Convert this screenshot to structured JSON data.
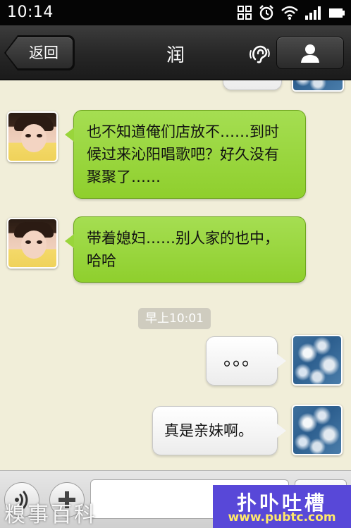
{
  "status_bar": {
    "time": "10:14",
    "icons": [
      "screen-rotate-icon",
      "alarm-icon",
      "wifi-icon",
      "signal-icon",
      "battery-icon"
    ]
  },
  "title_bar": {
    "back_label": "返回",
    "title": "润",
    "earpiece_icon": "earpiece-icon",
    "profile_icon": "person-icon"
  },
  "messages": [
    {
      "direction": "incoming",
      "text": "也不知道俺们店放不……到时候过来沁阳唱歌吧？好久没有聚聚了……"
    },
    {
      "direction": "incoming",
      "text": "带着媳妇……别人家的也中，哈哈"
    },
    {
      "direction": "outgoing",
      "text": "。。。"
    },
    {
      "direction": "outgoing",
      "text": "真是亲妹啊。"
    }
  ],
  "time_divider": "早上10:01",
  "input_bar": {
    "voice_icon": "voice-icon",
    "plus_icon": "plus-icon",
    "input_value": "",
    "input_placeholder": ""
  },
  "watermarks": {
    "left": "糗事百科",
    "brand": "扑卟吐槽",
    "url": "www.pubtc.com"
  },
  "colors": {
    "chat_background": "#f1eed9",
    "incoming_bubble": "#99d53b",
    "outgoing_bubble": "#f5f5f5",
    "title_bar": "#262626",
    "watermark_bg": "#5848d8"
  }
}
